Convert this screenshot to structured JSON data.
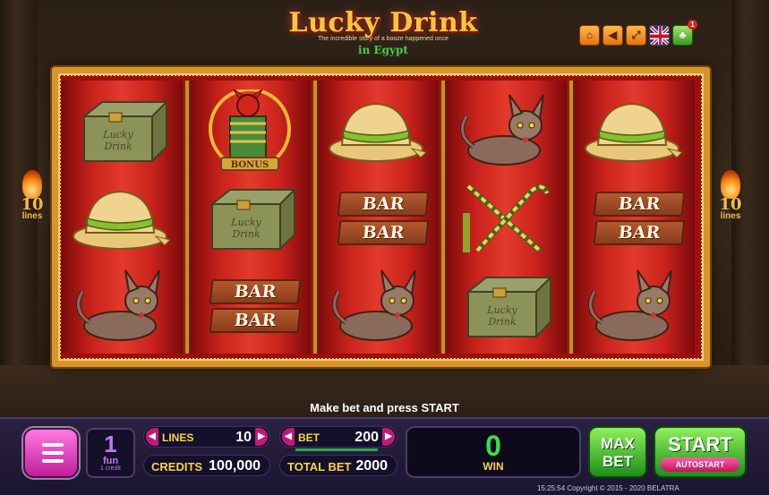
{
  "title": {
    "main": "Lucky Drink",
    "subtitle": "The incredible story of a booze happened once",
    "place": "in Egypt"
  },
  "top_buttons": [
    {
      "name": "home",
      "icon": "home-icon",
      "glyph": "⌂"
    },
    {
      "name": "paytable",
      "icon": "paytable-icon",
      "glyph": "◀"
    },
    {
      "name": "fullscreen",
      "icon": "fullscreen-icon",
      "glyph": "⤢"
    },
    {
      "name": "language",
      "icon": "uk-flag-icon",
      "glyph": ""
    },
    {
      "name": "club",
      "icon": "club-icon",
      "glyph": "♣",
      "badge": "1"
    }
  ],
  "reels": [
    [
      "chest",
      "helmet",
      "cat"
    ],
    [
      "devil-bonus",
      "chest",
      "bar-bar"
    ],
    [
      "helmet",
      "bar-bar",
      "cat"
    ],
    [
      "cat",
      "canes",
      "chest"
    ],
    [
      "helmet",
      "bar-bar",
      "cat"
    ]
  ],
  "symbols": {
    "bar_text": "BAR",
    "bonus_text": "BONUS",
    "chest_text_1": "Lucky",
    "chest_text_2": "Drink"
  },
  "lines_indicator": {
    "count": "10",
    "label": "lines"
  },
  "prompt": "Make bet and press START",
  "panel": {
    "fun": {
      "value": "1",
      "unit": "fun",
      "caption": "1 credit"
    },
    "lines": {
      "label": "LINES",
      "value": "10"
    },
    "bet": {
      "label": "BET",
      "value": "200"
    },
    "credits": {
      "label": "CREDITS",
      "value": "100,000"
    },
    "total_bet": {
      "label": "TOTAL BET",
      "value": "2000"
    },
    "win": {
      "label": "WIN",
      "value": "0"
    },
    "max_bet": {
      "line1": "MAX",
      "line2": "BET"
    },
    "start": {
      "label": "START",
      "autostart": "AUTOSTART"
    }
  },
  "footer": "15:25:54   Copyright © 2015 - 2020   BELATRA",
  "colors": {
    "reel_red": "#c9221c",
    "frame_gold": "#d7952d",
    "win_green": "#34e04a",
    "label_yellow": "#f7d34a",
    "menu_pink": "#c01e9a"
  }
}
